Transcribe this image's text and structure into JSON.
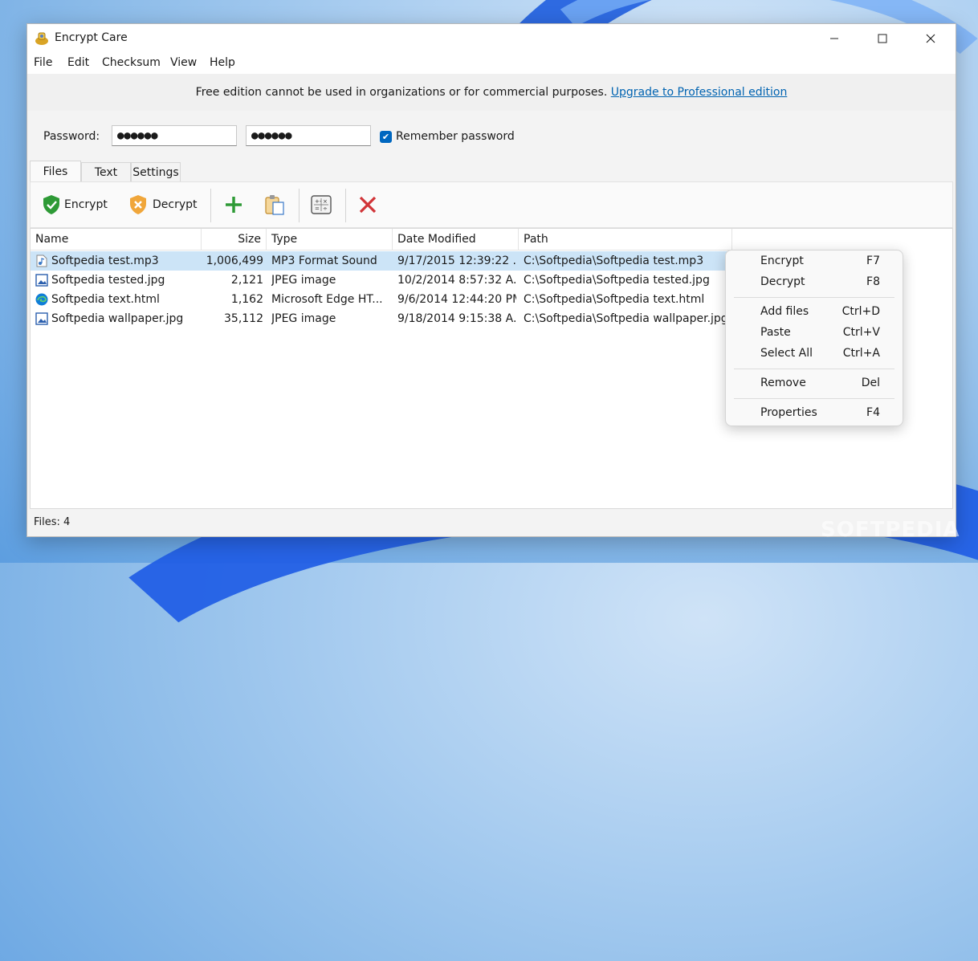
{
  "window": {
    "title": "Encrypt Care"
  },
  "menu": [
    "File",
    "Edit",
    "Checksum",
    "View",
    "Help"
  ],
  "banner": {
    "text": "Free edition cannot be used in organizations or for commercial purposes.",
    "link": "Upgrade to Professional edition"
  },
  "password": {
    "label": "Password:",
    "value1": "●●●●●●",
    "value2": "●●●●●●",
    "remember_label": "Remember password",
    "remember_checked": true
  },
  "tabs": [
    "Files",
    "Text",
    "Settings"
  ],
  "toolbar": {
    "encrypt": "Encrypt",
    "decrypt": "Decrypt"
  },
  "columns": [
    "Name",
    "Size",
    "Type",
    "Date Modified",
    "Path"
  ],
  "files": [
    {
      "name": "Softpedia test.mp3",
      "size": "1,006,499",
      "type": "MP3 Format Sound",
      "date": "9/17/2015 12:39:22 ...",
      "path": "C:\\Softpedia\\Softpedia test.mp3",
      "icon": "audio-file-icon",
      "selected": true
    },
    {
      "name": "Softpedia tested.jpg",
      "size": "2,121",
      "type": "JPEG image",
      "date": "10/2/2014 8:57:32 A...",
      "path": "C:\\Softpedia\\Softpedia tested.jpg",
      "icon": "image-file-icon",
      "selected": false
    },
    {
      "name": "Softpedia text.html",
      "size": "1,162",
      "type": "Microsoft Edge HT...",
      "date": "9/6/2014 12:44:20 PM",
      "path": "C:\\Softpedia\\Softpedia text.html",
      "icon": "edge-file-icon",
      "selected": false
    },
    {
      "name": "Softpedia wallpaper.jpg",
      "size": "35,112",
      "type": "JPEG image",
      "date": "9/18/2014 9:15:38 A...",
      "path": "C:\\Softpedia\\Softpedia wallpaper.jpg",
      "icon": "image-file-icon",
      "selected": false
    }
  ],
  "status": "Files: 4",
  "context_menu": [
    {
      "label": "Encrypt",
      "key": "F7"
    },
    {
      "label": "Decrypt",
      "key": "F8"
    },
    {
      "label": "Add files",
      "key": "Ctrl+D"
    },
    {
      "label": "Paste",
      "key": "Ctrl+V"
    },
    {
      "label": "Select All",
      "key": "Ctrl+A"
    },
    {
      "label": "Remove",
      "key": "Del"
    },
    {
      "label": "Properties",
      "key": "F4"
    }
  ],
  "watermark": "SOFTPEDIA",
  "colors": {
    "accent": "#0067c0",
    "selection": "#cce4f7",
    "link": "#0063b1",
    "add": "#2e9a36",
    "remove": "#d13438"
  }
}
